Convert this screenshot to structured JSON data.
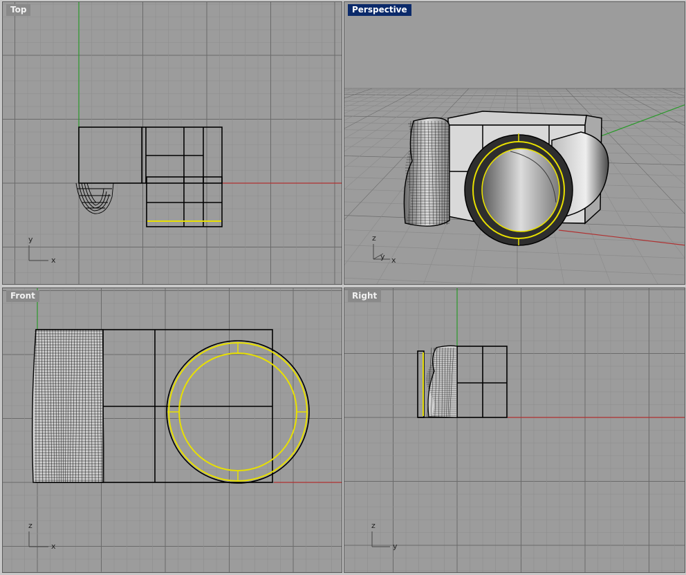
{
  "viewports": {
    "top": {
      "label": "Top",
      "active": false,
      "axes": [
        "y",
        "x"
      ]
    },
    "perspective": {
      "label": "Perspective",
      "active": true,
      "axes": [
        "z",
        "y",
        "x"
      ]
    },
    "front": {
      "label": "Front",
      "active": false,
      "axes": [
        "z",
        "x"
      ]
    },
    "right": {
      "label": "Right",
      "active": false,
      "axes": [
        "z",
        "y"
      ]
    }
  },
  "colors": {
    "viewport_bg": "#9c9c9c",
    "grid_minor": "#8e8e8e",
    "grid_major": "#6a6a6a",
    "x_axis": "#b03030",
    "y_axis": "#2a9a2a",
    "selection": "#e8e000",
    "active_label_bg": "#0b2a6a"
  }
}
